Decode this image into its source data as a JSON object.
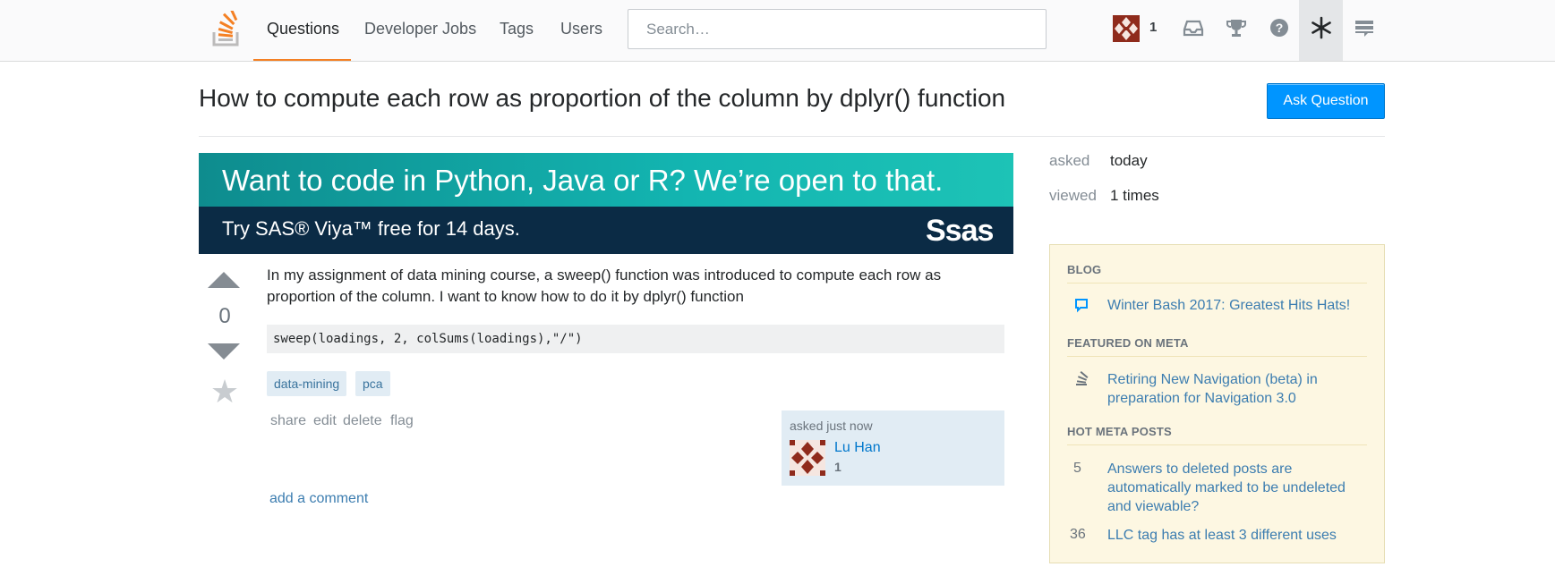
{
  "header": {
    "nav": [
      "Questions",
      "Developer Jobs",
      "Tags",
      "Users"
    ],
    "search_placeholder": "Search…",
    "reputation": "1",
    "icons": [
      "inbox-icon",
      "trophy-icon",
      "help-icon",
      "winter-bash-icon",
      "site-switcher-icon"
    ]
  },
  "question": {
    "title": "How to compute each row as proportion of the column by dplyr() function",
    "ask_button": "Ask Question",
    "votes": "0",
    "body": "In my assignment of data mining course, a sweep() function was introduced to compute each row as proportion of the column. I want to know how to do it by dplyr() function",
    "code": "sweep(loadings, 2, colSums(loadings),\"/\")",
    "tags": [
      "data-mining",
      "pca"
    ],
    "menu": [
      "share",
      "edit",
      "delete",
      "flag"
    ],
    "owner": {
      "time": "asked just now",
      "name": "Lu Han",
      "rep": "1"
    },
    "add_comment": "add a comment"
  },
  "ad": {
    "headline": "Want to code in Python, Java or R? We’re open to that.",
    "subline": "Try SAS® Viya™ free for 14 days.",
    "logo": "Ssas"
  },
  "stats": {
    "asked_label": "asked",
    "asked_value": "today",
    "viewed_label": "viewed",
    "viewed_value": "1 times"
  },
  "sidebar": {
    "blog_heading": "BLOG",
    "blog_item": "Winter Bash 2017: Greatest Hits Hats!",
    "meta_heading": "FEATURED ON META",
    "meta_item": "Retiring New Navigation (beta) in preparation for Navigation 3.0",
    "hot_heading": "HOT META POSTS",
    "hot_items": [
      {
        "count": "5",
        "text": "Answers to deleted posts are automatically marked to be undeleted and viewable?"
      },
      {
        "count": "36",
        "text": "LLC tag has at least 3 different uses"
      }
    ]
  },
  "colors": {
    "accent": "#f48024",
    "link": "#3c7db0",
    "button": "#0095ff",
    "tag_bg": "#e1ecf4",
    "sidebar_bg": "#fdf7e2"
  }
}
